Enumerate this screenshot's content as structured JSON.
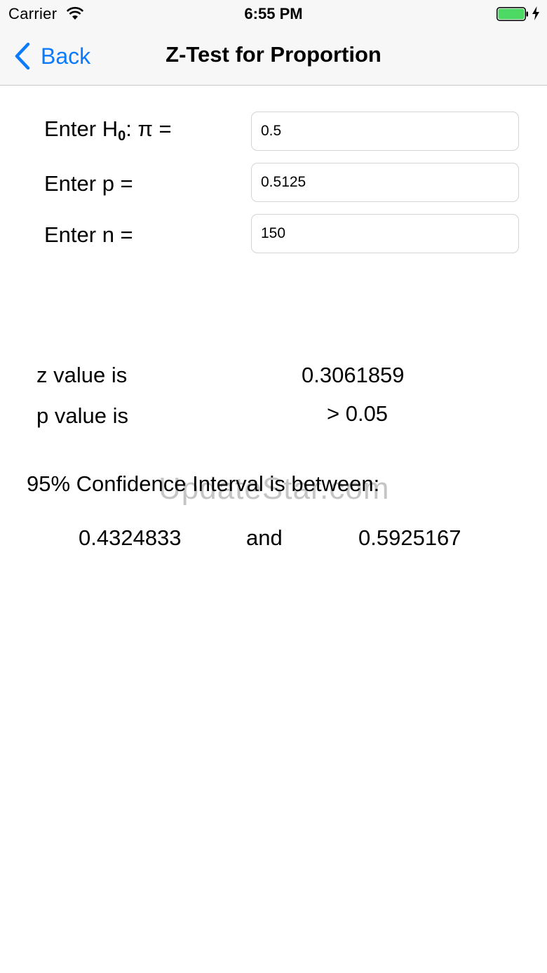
{
  "status_bar": {
    "carrier": "Carrier",
    "time": "6:55 PM",
    "battery_color": "#4cd964"
  },
  "nav": {
    "back_label": "Back",
    "title": "Z-Test for Proportion",
    "accent_color": "#0b7bfe"
  },
  "form": {
    "h0": {
      "label_prefix": "Enter H",
      "label_sub": "0",
      "label_suffix": ": π =",
      "value": "0.5"
    },
    "p": {
      "label": "Enter p =",
      "value": "0.5125"
    },
    "n": {
      "label": "Enter n =",
      "value": "150"
    }
  },
  "results": {
    "z_label": "z value is",
    "z_value": "0.3061859",
    "p_label": "p value is",
    "p_value": "> 0.05"
  },
  "confidence_interval": {
    "heading": "95% Confidence Interval is between:",
    "lower": "0.4324833",
    "connector": "and",
    "upper": "0.5925167"
  },
  "watermark": "UpdateStar.com"
}
